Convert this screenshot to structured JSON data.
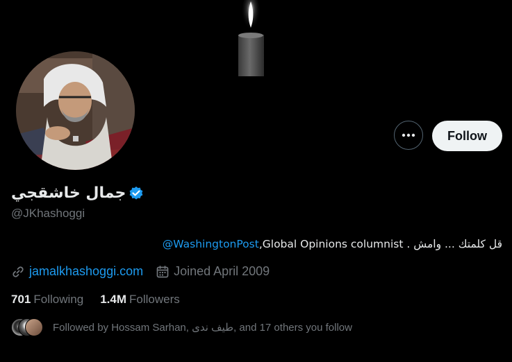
{
  "profile": {
    "display_name": "جمال خاشقجي",
    "handle": "@JKhashoggi",
    "bio_text": "قل كلمتك ... وامش . Global Opinions columnist, ",
    "bio_mention": "@WashingtonPost",
    "website": "jamalkhashoggi.com",
    "joined": "Joined April 2009",
    "following_count": "701",
    "following_label": "Following",
    "followers_count": "1.4M",
    "followers_label": "Followers",
    "followed_by": "Followed by Hossam Sarhan, طيف ندى, and 17 others you follow"
  },
  "actions": {
    "follow_label": "Follow"
  },
  "icons": {
    "verified": "verified-badge-icon",
    "link": "link-icon",
    "calendar": "calendar-icon",
    "more": "more-dots-icon"
  },
  "colors": {
    "accent": "#1d9bf0",
    "background": "#000000",
    "muted": "#71767b",
    "text": "#e7e9ea"
  }
}
